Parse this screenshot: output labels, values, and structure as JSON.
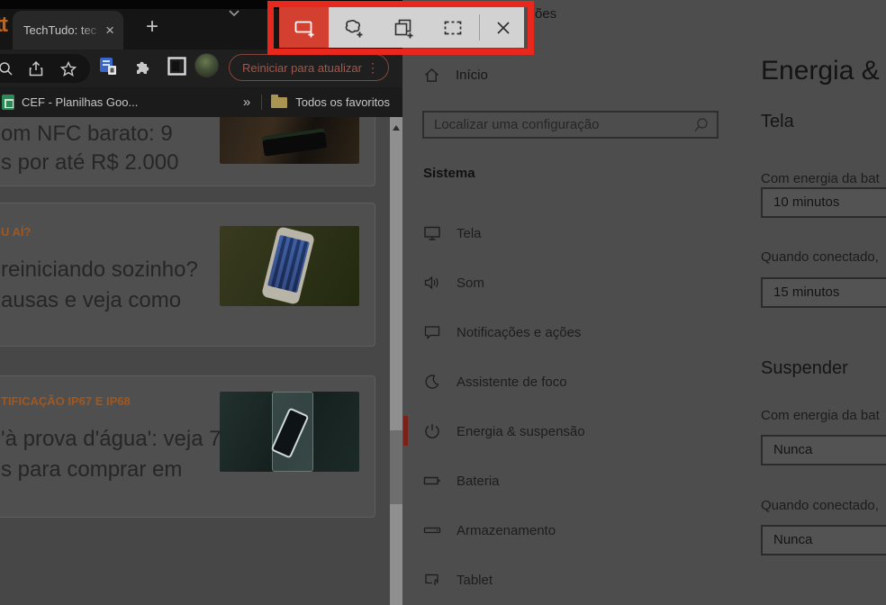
{
  "annotation": {
    "highlight_color": "#e8271d",
    "target": "snip-toolbar"
  },
  "snip_toolbar": {
    "bar_bg": "#d2d2d2",
    "selected_bg": "#d4402f",
    "selected_mode": "rectangular-snip",
    "buttons": [
      {
        "name": "rectangular-snip"
      },
      {
        "name": "freeform-snip"
      },
      {
        "name": "window-snip"
      },
      {
        "name": "fullscreen-snip"
      },
      {
        "name": "close"
      }
    ]
  },
  "browser": {
    "logo_fragment": "tt",
    "tab": {
      "title": "TechTudo: tec",
      "close_glyph": "×"
    },
    "new_tab_glyph": "+",
    "toolbar": {
      "update_button": "Reiniciar para atualizar",
      "menu_glyph": "⋮"
    },
    "bookmarks": {
      "first_item": "CEF - Planilhas Goo...",
      "overflow_glyph": "»",
      "folder_label": "Todos os favoritos"
    },
    "articles": [
      {
        "category": "",
        "line1": "om NFC barato: 9",
        "line2": "s por até R$ 2.000",
        "image": "payment-terminal-photo"
      },
      {
        "category": "U AÍ?",
        "line1": "reiniciando sozinho?",
        "line2": "ausas e veja como",
        "image": "iphone-in-hand-photo"
      },
      {
        "category": "TIFICAÇÃO IP67 E IP68",
        "line1": "'à prova d'água': veja 7",
        "line2": "s para comprar em",
        "image": "phone-in-water-glass-photo"
      }
    ],
    "category_color": "#a1571e"
  },
  "settings": {
    "window_title_fragment": "ões",
    "home_label": "Início",
    "search_placeholder": "Localizar uma configuração",
    "section_header": "Sistema",
    "accent_color": "#7c211a",
    "selected_item": "Energia & suspensão",
    "items": [
      {
        "label": "Tela",
        "icon": "display-icon"
      },
      {
        "label": "Som",
        "icon": "speaker-icon"
      },
      {
        "label": "Notificações e ações",
        "icon": "notifications-icon"
      },
      {
        "label": "Assistente de foco",
        "icon": "focus-moon-icon"
      },
      {
        "label": "Energia & suspensão",
        "icon": "power-icon"
      },
      {
        "label": "Bateria",
        "icon": "battery-icon"
      },
      {
        "label": "Armazenamento",
        "icon": "storage-icon"
      },
      {
        "label": "Tablet",
        "icon": "tablet-icon"
      }
    ],
    "page": {
      "title": "Energia &",
      "groups": [
        {
          "heading": "Tela",
          "fields": [
            {
              "label": "Com energia da bat",
              "value": "10 minutos"
            },
            {
              "label": "Quando conectado,",
              "value": "15 minutos"
            }
          ]
        },
        {
          "heading": "Suspender",
          "fields": [
            {
              "label": "Com energia da bat",
              "value": "Nunca"
            },
            {
              "label": "Quando conectado,",
              "value": "Nunca"
            }
          ]
        }
      ]
    }
  }
}
